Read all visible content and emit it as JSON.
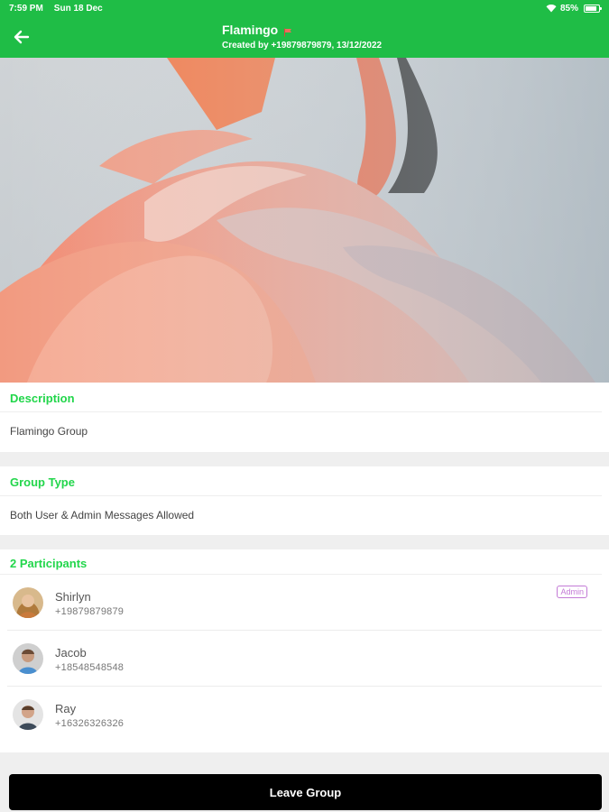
{
  "status_bar": {
    "time": "7:59 PM",
    "date": "Sun 18 Dec",
    "battery": "85%",
    "battery_level": 0.85,
    "icons": [
      "wifi-icon",
      "battery-icon"
    ]
  },
  "header": {
    "title": "Flamingo",
    "subtitle": "Created by +19879879879, 13/12/2022",
    "back_icon": "arrow-left-icon",
    "flag_icon": "flag-icon"
  },
  "description": {
    "heading": "Description",
    "text": "Flamingo Group"
  },
  "group_type": {
    "heading": "Group Type",
    "text": "Both User & Admin Messages Allowed"
  },
  "participants": {
    "heading": "2 Participants",
    "items": [
      {
        "name": "Shirlyn",
        "phone": "+19879879879",
        "badge": "Admin"
      },
      {
        "name": "Jacob",
        "phone": "+18548548548",
        "badge": ""
      },
      {
        "name": "Ray",
        "phone": "+16326326326",
        "badge": ""
      }
    ]
  },
  "actions": {
    "leave_label": "Leave Group"
  },
  "colors": {
    "accent": "#1fbd46",
    "heading_green": "#22d64b",
    "admin_badge": "#c37ad6",
    "button_bg": "#000000"
  }
}
